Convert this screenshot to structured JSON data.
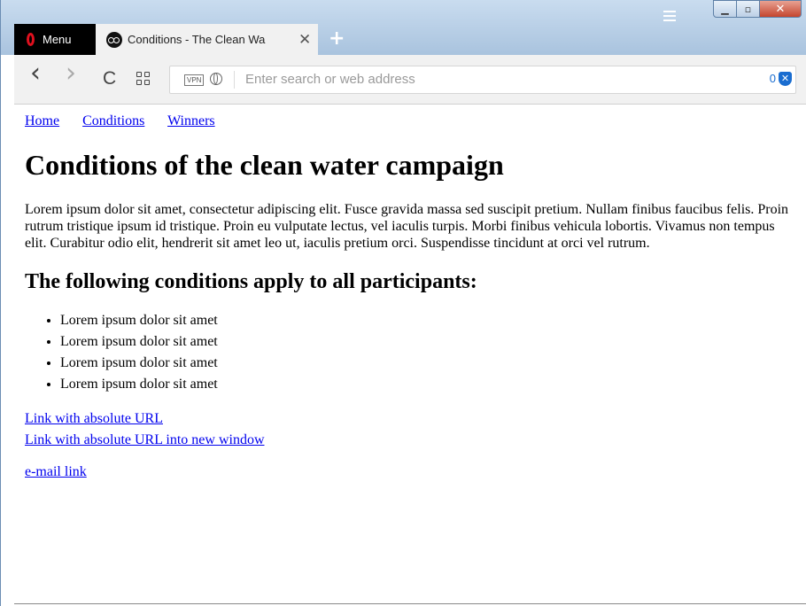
{
  "browser": {
    "menu_label": "Menu",
    "tab": {
      "title": "Conditions - The Clean Wa",
      "close_glyph": "✕"
    },
    "new_tab_glyph": "+",
    "window_controls": {
      "minimize": "▁",
      "maximize": "▫",
      "close": "✕"
    },
    "address_bar": {
      "placeholder": "Enter search or web address",
      "vpn_label": "VPN",
      "blocked_count": "0",
      "shield_glyph": "✕"
    },
    "nav_buttons": {
      "back": "‹",
      "forward": "›",
      "reload": "C"
    }
  },
  "page": {
    "nav": [
      "Home",
      "Conditions",
      "Winners"
    ],
    "title": "Conditions of the clean water campaign",
    "intro": "Lorem ipsum dolor sit amet, consectetur adipiscing elit. Fusce gravida massa sed suscipit pretium. Nullam finibus faucibus felis. Proin rutrum tristique ipsum id tristique. Proin eu vulputate lectus, vel iaculis turpis. Morbi finibus vehicula lobortis. Vivamus non tempus elit. Curabitur odio elit, hendrerit sit amet leo ut, iaculis pretium orci. Suspendisse tincidunt at orci vel rutrum.",
    "subtitle": "The following conditions apply to all participants:",
    "conditions": [
      "Lorem ipsum dolor sit amet",
      "Lorem ipsum dolor sit amet",
      "Lorem ipsum dolor sit amet",
      "Lorem ipsum dolor sit amet"
    ],
    "links": [
      "Link with absolute URL",
      "Link with absolute URL into new window"
    ],
    "email_link": "e-mail link"
  },
  "colors": {
    "link": "#0000ee",
    "menu_bg": "#000000",
    "opera_red": "#e0101e",
    "accent_blue": "#1a6dd0"
  }
}
